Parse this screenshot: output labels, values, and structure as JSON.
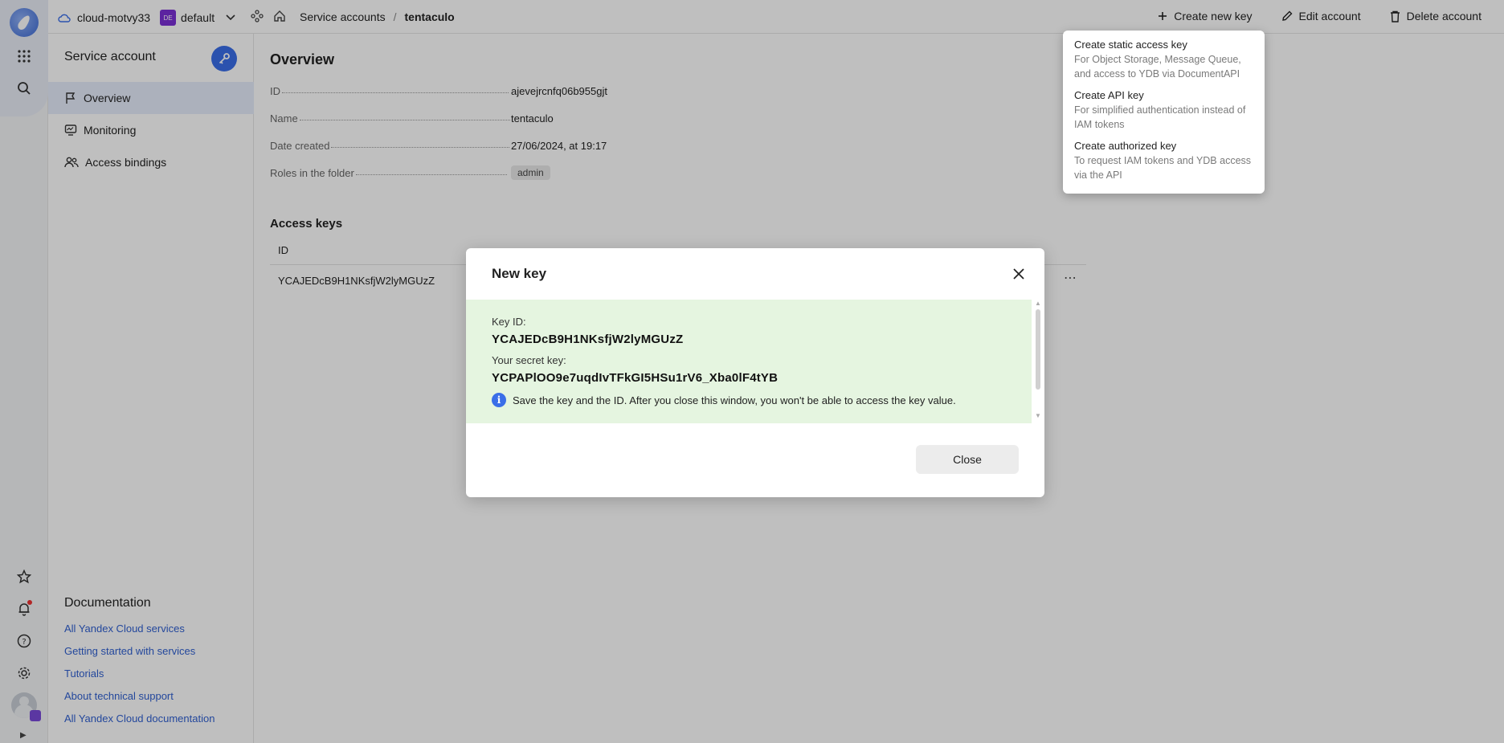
{
  "header": {
    "cloud_name": "cloud-motvy33",
    "folder_badge": "DE",
    "folder_name": "default",
    "breadcrumb_parent": "Service accounts",
    "breadcrumb_separator": "/",
    "breadcrumb_current": "tentaculo",
    "actions": {
      "create_new_key": "Create new key",
      "edit_account": "Edit account",
      "delete_account": "Delete account"
    }
  },
  "sidebar": {
    "title": "Service account",
    "items": [
      {
        "label": "Overview",
        "icon": "flag-icon",
        "active": true
      },
      {
        "label": "Monitoring",
        "icon": "monitor-icon",
        "active": false
      },
      {
        "label": "Access bindings",
        "icon": "users-icon",
        "active": false
      }
    ],
    "documentation": {
      "title": "Documentation",
      "links": [
        "All Yandex Cloud services",
        "Getting started with services",
        "Tutorials",
        "About technical support",
        "All Yandex Cloud documentation"
      ]
    }
  },
  "overview": {
    "title": "Overview",
    "properties": [
      {
        "label": "ID",
        "value": "ajevejrcnfq06b955gjt"
      },
      {
        "label": "Name",
        "value": "tentaculo"
      },
      {
        "label": "Date created",
        "value": "27/06/2024, at 19:17"
      },
      {
        "label": "Roles in the folder",
        "value": "admin"
      }
    ]
  },
  "access_keys": {
    "title": "Access keys",
    "columns": [
      "ID"
    ],
    "rows": [
      [
        "YCAJEDcB9H1NKsfjW2lyMGUzZ"
      ]
    ],
    "more_glyph": "⋯"
  },
  "dropdown": {
    "items": [
      {
        "title": "Create static access key",
        "desc": "For Object Storage, Message Queue, and access to YDB via DocumentAPI"
      },
      {
        "title": "Create API key",
        "desc": "For simplified authentication instead of IAM tokens"
      },
      {
        "title": "Create authorized key",
        "desc": "To request IAM tokens and YDB access via the API"
      }
    ]
  },
  "modal": {
    "title": "New key",
    "key_id_label": "Key ID:",
    "key_id_value": "YCAJEDcB9H1NKsfjW2lyMGUzZ",
    "secret_label": "Your secret key:",
    "secret_value": "YCPAPlOO9e7uqdIvTFkGI5HSu1rV6_Xba0lF4tYB",
    "info_text": "Save the key and the ID. After you close this window, you won't be able to access the key value.",
    "close_button": "Close"
  },
  "colors": {
    "accent": "#3a6ee8",
    "success_bg": "#e5f5e0",
    "folder_badge": "#7b2fd6"
  }
}
